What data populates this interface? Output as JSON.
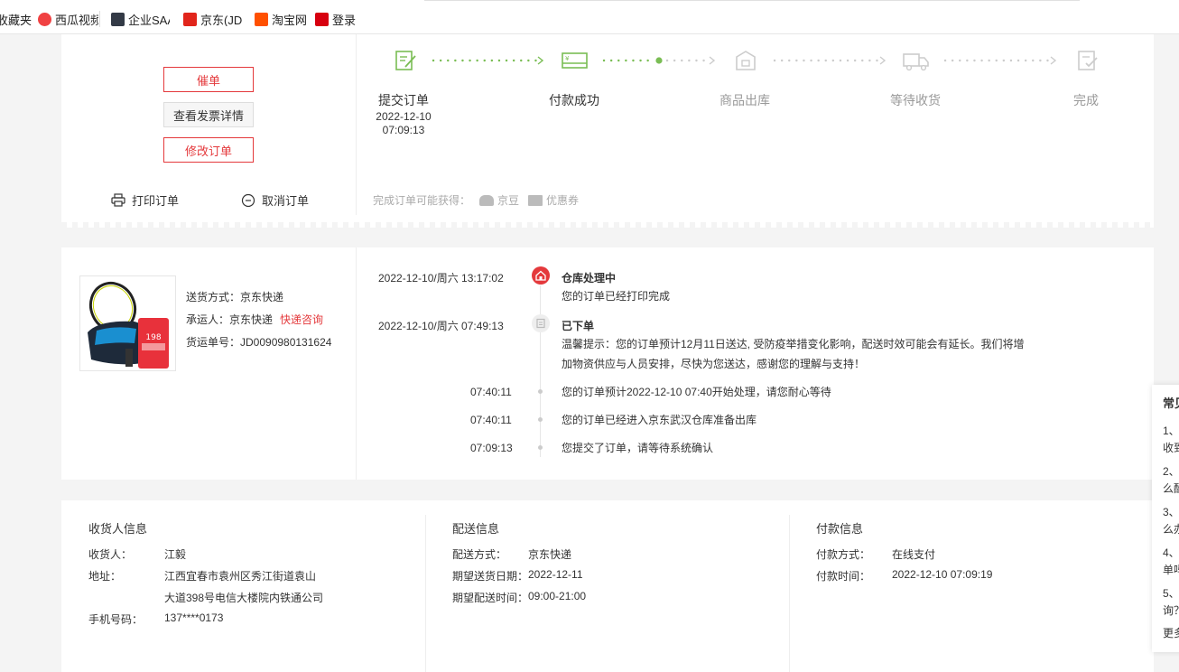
{
  "bookmarks": [
    {
      "label": "收藏夹",
      "color": "#ffffff"
    },
    {
      "label": "西瓜视频",
      "color": "#f04142"
    },
    {
      "label": "企业SAAS",
      "color": "#333a46"
    },
    {
      "label": "京东(JD)",
      "color": "#e1251b"
    },
    {
      "label": "淘宝网",
      "color": "#ff5000"
    },
    {
      "label": "登录",
      "color": "#d7000f"
    }
  ],
  "order_actions": {
    "urge": "催单",
    "invoice": "查看发票详情",
    "modify": "修改订单",
    "print": "打印订单",
    "cancel": "取消订单"
  },
  "progress": {
    "steps": [
      {
        "label": "提交订单",
        "date": "2022-12-10",
        "time": "07:09:13",
        "done": true
      },
      {
        "label": "付款成功",
        "done": true
      },
      {
        "label": "商品出库",
        "done": false
      },
      {
        "label": "等待收货",
        "done": false
      },
      {
        "label": "完成",
        "done": false
      }
    ],
    "reward_label": "完成订单可能获得：",
    "reward_beans": "京豆",
    "reward_coupon": "优惠券",
    "active_color": "#7abd54"
  },
  "shipping": {
    "method": "送货方式：京东快递",
    "carrier": "承运人：京东快递",
    "consult": "快递咨询",
    "tracking": "货运单号：JD0090980131624"
  },
  "product_image": {
    "price_tag": "198"
  },
  "timeline": [
    {
      "time": "2022-12-10/周六   13:17:02",
      "title": "仓库处理中",
      "text": "您的订单已经打印完成"
    },
    {
      "time": "2022-12-10/周六   07:49:13",
      "title": "已下单",
      "text": "温馨提示：您的订单预计12月11日送达, 受防疫举措变化影响，配送时效可能会有延长。我们将增加物资供应与人员安排，尽快为您送达，感谢您的理解与支持！"
    },
    {
      "time": "07:40:11",
      "text": "您的订单预计2022-12-10 07:40开始处理，请您耐心等待"
    },
    {
      "time": "07:40:11",
      "text": "您的订单已经进入京东武汉仓库准备出库"
    },
    {
      "time": "07:09:13",
      "text": "您提交了订单，请等待系统确认"
    }
  ],
  "receiver": {
    "title": "收货人信息",
    "name_label": "收货人：",
    "name": "江毅",
    "address_label": "地址：",
    "address1": "江西宜春市袁州区秀江街道袁山",
    "address2": "大道398号电信大楼院内铁通公司",
    "phone_label": "手机号码：",
    "phone": "137****0173"
  },
  "delivery": {
    "title": "配送信息",
    "method_label": "配送方式：",
    "method": "京东快递",
    "date_label": "期望送货日期：",
    "date": "2022-12-11",
    "time_label": "期望配送时间：",
    "time": "09:00-21:00"
  },
  "payment": {
    "title": "付款信息",
    "method_label": "付款方式：",
    "method": "在线支付",
    "time_label": "付款时间：",
    "time": "2022-12-10 07:09:19"
  },
  "faq": {
    "title": "常见",
    "items": [
      "1、",
      "收到",
      "2、",
      "么酝",
      "3、",
      "么办",
      "4、",
      "单吗",
      "5、",
      "询？",
      "更多"
    ]
  }
}
